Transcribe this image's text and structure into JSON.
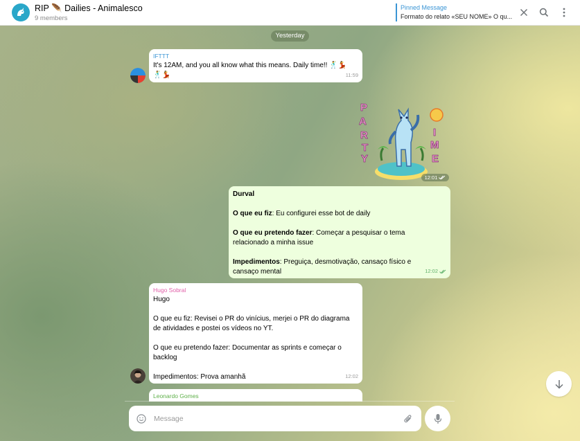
{
  "header": {
    "title": "RIP 🪶 Dailies - Animalesco",
    "subtitle": "9 members",
    "pinned_title": "Pinned Message",
    "pinned_text": "Formato do relato «SEU NOME» O qu...",
    "icons": [
      "close-icon",
      "search-icon",
      "more-vertical-icon"
    ]
  },
  "date_label": "Yesterday",
  "messages": [
    {
      "sender": "IFTTT",
      "text": "It's 12AM, and you all know what this means. Daily time!! 🕺💃",
      "text2": "🕺💃",
      "time": "11:59"
    },
    {
      "sticker_time": "12:01",
      "sticker_text": "PARTY TIME"
    },
    {
      "sender": "Durval",
      "l1_bold": "O que eu fiz",
      "l1": ": Eu configurei esse bot de daily",
      "l2_bold": "O que eu pretendo fazer",
      "l2": ": Começar a pesquisar o tema",
      "l2b": "relacionado a minha issue",
      "l3_bold": "Impedimentos",
      "l3": ": Preguiça, desmotivação, cansaço físico e",
      "l3b": "cansaço mental",
      "time": "12:02"
    },
    {
      "sender": "Hugo Sobral",
      "name_line": "Hugo",
      "l1": "O que eu fiz: Revisei o PR do vinícius, merjei o PR do diagrama",
      "l1b": "de atividades e postei os vídeos no YT.",
      "l2": "O que eu pretendo fazer: Documentar as sprints e começar o",
      "l2b": "backlog",
      "l3": "Impedimentos: Prova amanhã",
      "time": "12:02"
    },
    {
      "sender": "Leonardo Gomes"
    }
  ],
  "composer": {
    "placeholder": "Message"
  },
  "colors": {
    "accent": "#3a95d5",
    "hugo": "#e05ea7",
    "leonardo": "#5fb04a",
    "ifttt": "#3a95d5"
  }
}
